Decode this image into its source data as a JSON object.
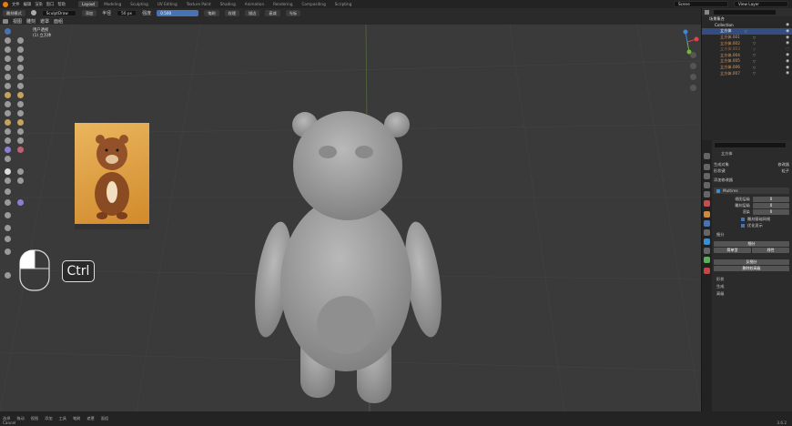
{
  "topbar": {
    "menus": [
      "文件",
      "编辑",
      "渲染",
      "窗口",
      "帮助"
    ],
    "tabs": [
      "Layout",
      "Modeling",
      "Sculpting",
      "UV Editing",
      "Texture Paint",
      "Shading",
      "Animation",
      "Rendering",
      "Compositing",
      "Scripting"
    ],
    "active_tab": "Layout",
    "scene_label": "Scene",
    "view_layer_label": "View Layer"
  },
  "toolheader": {
    "mode": "雕刻模式",
    "brush": "SculptDraw",
    "blend": "添加",
    "radius_label": "半径",
    "radius_value": "50 px",
    "strength_label": "强度",
    "strength_value": "0.500",
    "menu_items": [
      "笔刷",
      "纹理",
      "描边",
      "衰减",
      "光标"
    ]
  },
  "viewheader": {
    "items": [
      "视图",
      "雕刻",
      "遮罩",
      "面组"
    ]
  },
  "viewport": {
    "perspective_label": "用户透视",
    "object_label": "(1) 立方体"
  },
  "overlay": {
    "key": "Ctrl"
  },
  "outliner": {
    "title": "场景集合",
    "collection": "Collection",
    "items": [
      "立方体",
      "立方体.001",
      "立方体.002",
      "立方体.003",
      "立方体.004",
      "立方体.005",
      "立方体.006",
      "立方体.007"
    ],
    "selected_index": 0
  },
  "properties": {
    "object": "立方体",
    "rows": [
      [
        "生成对象",
        "修改器"
      ],
      [
        "形状键",
        "粒子"
      ]
    ],
    "add_modifier": "添加修改器",
    "modifier_name": "Multires",
    "fields": [
      {
        "label": "视图层级",
        "value": "0"
      },
      {
        "label": "雕刻层级",
        "value": "0"
      },
      {
        "label": "渲染",
        "value": "0"
      }
    ],
    "checks": [
      "雕刻基础网格",
      "优化显示"
    ],
    "section_subdivide": "细分",
    "buttons": [
      "细分",
      "简单型",
      "线性",
      "反细分",
      "删除较高级"
    ],
    "sub_sections": [
      "形状",
      "生成",
      "高级"
    ]
  },
  "status": {
    "items": [
      "选择",
      "拖动",
      "视图",
      "添加",
      "工具",
      "笔刷",
      "遮罩",
      "面组"
    ],
    "left_hint": "Cancel",
    "version": "3.6.2"
  },
  "colors": {
    "accent": "#4772b3",
    "selected_row": "#334d80",
    "viewport_bg": "#3a3a3a"
  }
}
